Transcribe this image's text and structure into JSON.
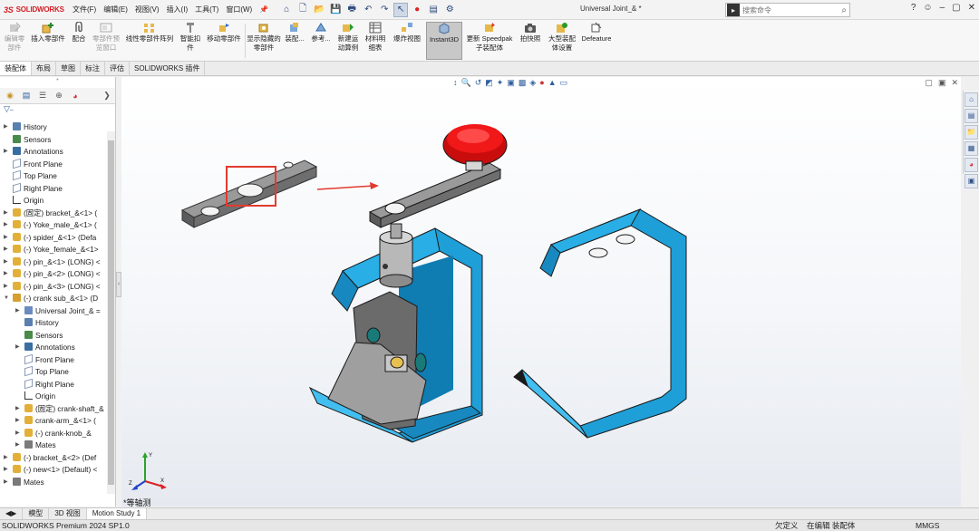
{
  "app": {
    "brand": "SOLIDWORKS",
    "window_title": "Universal Joint_& *",
    "menu": [
      "文件(F)",
      "编辑(E)",
      "视图(V)",
      "插入(I)",
      "工具(T)",
      "窗口(W)"
    ],
    "search_placeholder": "搜索命令"
  },
  "commands": [
    {
      "label": "编辑零部件",
      "disabled": true
    },
    {
      "label": "插入零部件",
      "disabled": false
    },
    {
      "label": "配合",
      "disabled": false
    },
    {
      "label": "零部件预览窗口",
      "disabled": true
    },
    {
      "label": "线性零部件阵列",
      "disabled": false
    },
    {
      "label": "智能扣件",
      "disabled": false
    },
    {
      "label": "移动零部件",
      "disabled": false
    },
    {
      "label": "显示隐藏的零部件",
      "disabled": false
    },
    {
      "label": "装配...",
      "disabled": false
    },
    {
      "label": "参考...",
      "disabled": false
    },
    {
      "label": "新建运动算例",
      "disabled": false
    },
    {
      "label": "材料明细表",
      "disabled": false
    },
    {
      "label": "爆炸视图",
      "disabled": false
    },
    {
      "label": "Instant3D",
      "disabled": false,
      "active": true
    },
    {
      "label": "更新 Speedpak 子装配体",
      "disabled": false
    },
    {
      "label": "拍快照",
      "disabled": false
    },
    {
      "label": "大型装配体设置",
      "disabled": false
    },
    {
      "label": "Defeature",
      "disabled": false
    }
  ],
  "tabs": [
    "装配体",
    "布局",
    "草图",
    "标注",
    "评估",
    "SOLIDWORKS 插件"
  ],
  "tree": [
    {
      "label": "History",
      "level": 0,
      "expand": true,
      "icon": "history-icon"
    },
    {
      "label": "Sensors",
      "level": 0,
      "expand": false,
      "icon": "sensor-icon"
    },
    {
      "label": "Annotations",
      "level": 0,
      "expand": true,
      "icon": "annotation-icon"
    },
    {
      "label": "Front Plane",
      "level": 0,
      "expand": false,
      "icon": "plane-icon"
    },
    {
      "label": "Top Plane",
      "level": 0,
      "expand": false,
      "icon": "plane-icon"
    },
    {
      "label": "Right Plane",
      "level": 0,
      "expand": false,
      "icon": "plane-icon"
    },
    {
      "label": "Origin",
      "level": 0,
      "expand": false,
      "icon": "origin-icon"
    },
    {
      "label": "(固定) bracket_&<1> (",
      "level": 0,
      "expand": true,
      "icon": "part-icon"
    },
    {
      "label": "(-) Yoke_male_&<1> (",
      "level": 0,
      "expand": true,
      "icon": "part-icon"
    },
    {
      "label": "(-) spider_&<1> (Defa",
      "level": 0,
      "expand": true,
      "icon": "part-icon"
    },
    {
      "label": "(-) Yoke_female_&<1>",
      "level": 0,
      "expand": true,
      "icon": "part-icon"
    },
    {
      "label": "(-) pin_&<1> (LONG) <",
      "level": 0,
      "expand": true,
      "icon": "part-icon"
    },
    {
      "label": "(-) pin_&<2> (LONG) <",
      "level": 0,
      "expand": true,
      "icon": "part-icon"
    },
    {
      "label": "(-) pin_&<3> (LONG) <",
      "level": 0,
      "expand": true,
      "icon": "part-icon"
    },
    {
      "label": "(-) crank sub_&<1> (D",
      "level": 0,
      "expand": "open",
      "icon": "assembly-icon"
    },
    {
      "label": "Universal Joint_& =",
      "level": 1,
      "expand": true,
      "icon": "assembly-ref-icon"
    },
    {
      "label": "History",
      "level": 1,
      "expand": false,
      "icon": "history-icon"
    },
    {
      "label": "Sensors",
      "level": 1,
      "expand": false,
      "icon": "sensor-icon"
    },
    {
      "label": "Annotations",
      "level": 1,
      "expand": true,
      "icon": "annotation-icon"
    },
    {
      "label": "Front Plane",
      "level": 1,
      "expand": false,
      "icon": "plane-icon"
    },
    {
      "label": "Top Plane",
      "level": 1,
      "expand": false,
      "icon": "plane-icon"
    },
    {
      "label": "Right Plane",
      "level": 1,
      "expand": false,
      "icon": "plane-icon"
    },
    {
      "label": "Origin",
      "level": 1,
      "expand": false,
      "icon": "origin-icon"
    },
    {
      "label": "(固定) crank-shaft_&",
      "level": 1,
      "expand": true,
      "icon": "part-icon"
    },
    {
      "label": "crank-arm_&<1> (",
      "level": 1,
      "expand": true,
      "icon": "part-icon"
    },
    {
      "label": "(-) crank-knob_&",
      "level": 1,
      "expand": true,
      "icon": "part-icon"
    },
    {
      "label": "Mates",
      "level": 1,
      "expand": true,
      "icon": "mates-icon"
    },
    {
      "label": "(-) bracket_&<2> (Def",
      "level": 0,
      "expand": true,
      "icon": "part-icon"
    },
    {
      "label": "(-) new<1> (Default) <",
      "level": 0,
      "expand": true,
      "icon": "part-icon"
    },
    {
      "label": "Mates",
      "level": 0,
      "expand": true,
      "icon": "mates-icon"
    }
  ],
  "viewport": {
    "view_label": "*等轴测"
  },
  "bottom_tabs": [
    "模型",
    "3D 视图",
    "Motion Study 1"
  ],
  "status": {
    "version": "SOLIDWORKS Premium 2024 SP1.0",
    "undefined": "欠定义",
    "editing": "在编辑 装配体",
    "units": "MMGS"
  },
  "colors": {
    "accent_blue": "#1f9fd8",
    "knob_red": "#e11414",
    "metal_gray": "#8a8a8a",
    "highlight_red": "#e23a2e"
  }
}
